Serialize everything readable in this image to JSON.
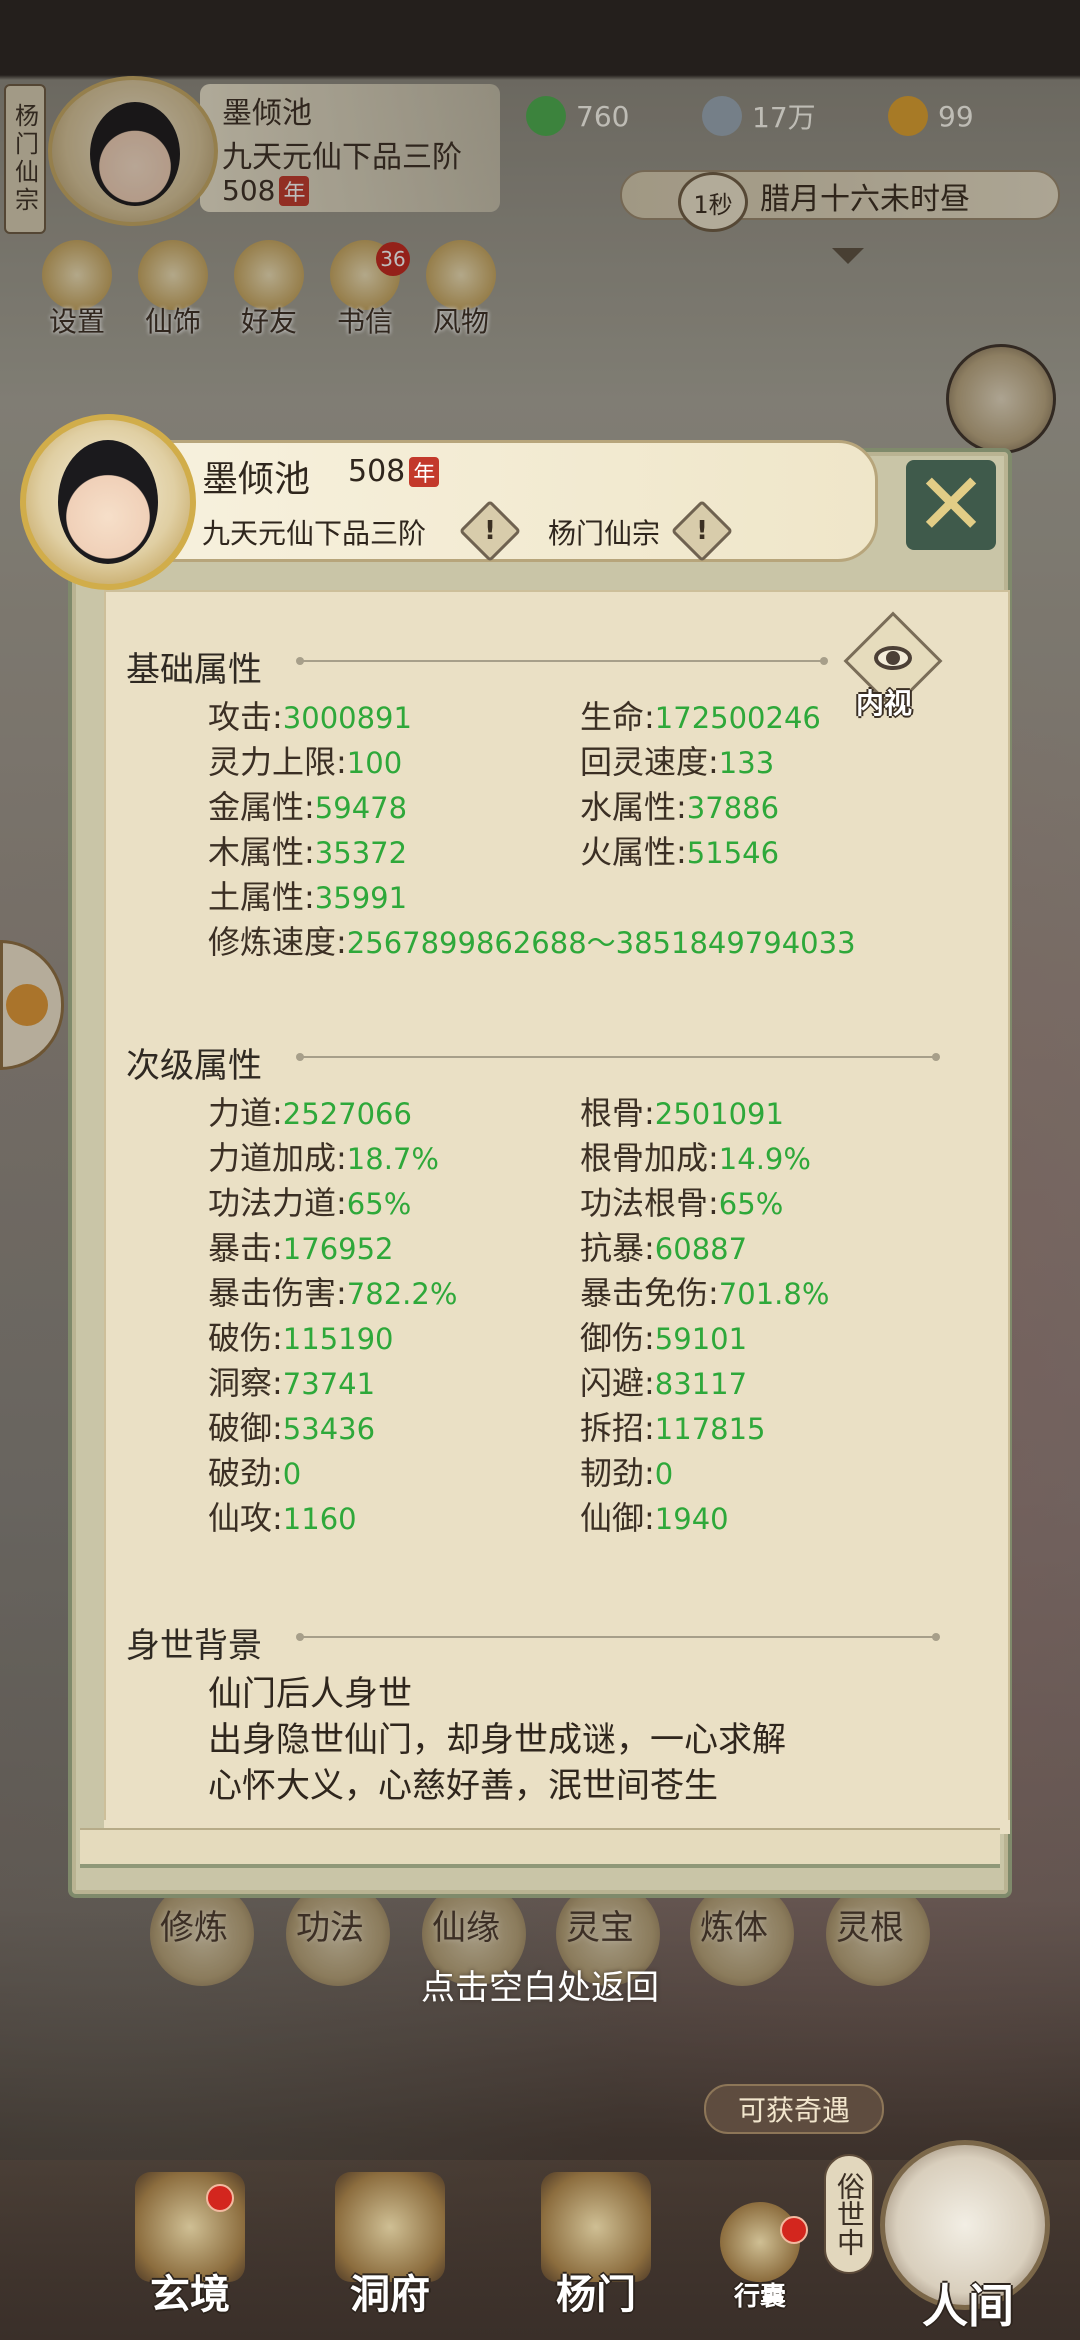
{
  "hud": {
    "sect_tag": "杨门仙宗",
    "name": "墨倾池",
    "rank": "九天元仙下品三阶",
    "age": "508",
    "age_unit": "年",
    "resources": [
      {
        "icon": "jade-leaf-icon",
        "value": "760",
        "color": "#4caf50"
      },
      {
        "icon": "coin-icon",
        "value": "17万",
        "color": "#9aa9b8"
      },
      {
        "icon": "gold-ingot-icon",
        "value": "99",
        "color": "#e0a330"
      }
    ],
    "time_speed": "1秒",
    "game_time": "腊月十六未时昼",
    "buttons": [
      {
        "label": "设置",
        "icon": "settings-icon"
      },
      {
        "label": "仙饰",
        "icon": "costume-icon"
      },
      {
        "label": "好友",
        "icon": "friends-icon"
      },
      {
        "label": "书信",
        "icon": "letter-icon"
      },
      {
        "label": "风物",
        "icon": "scenery-icon"
      }
    ],
    "mail_count": "36"
  },
  "modal": {
    "name": "墨倾池",
    "age": "508",
    "age_unit": "年",
    "rank": "九天元仙下品三阶",
    "sect": "杨门仙宗",
    "close_icon": "close-x-icon",
    "inner_view_label": "内视",
    "basic": {
      "title": "基础属性",
      "items": [
        {
          "label": "攻击",
          "value": "3000891"
        },
        {
          "label": "生命",
          "value": "172500246"
        },
        {
          "label": "灵力上限",
          "value": "100"
        },
        {
          "label": "回灵速度",
          "value": "133"
        },
        {
          "label": "金属性",
          "value": "59478"
        },
        {
          "label": "水属性",
          "value": "37886"
        },
        {
          "label": "木属性",
          "value": "35372"
        },
        {
          "label": "火属性",
          "value": "51546"
        },
        {
          "label": "土属性",
          "value": "35991"
        },
        {
          "label": "修炼速度",
          "value": "2567899862688～3851849794033"
        }
      ]
    },
    "secondary": {
      "title": "次级属性",
      "items": [
        {
          "label": "力道",
          "value": "2527066"
        },
        {
          "label": "根骨",
          "value": "2501091"
        },
        {
          "label": "力道加成",
          "value": "18.7%"
        },
        {
          "label": "根骨加成",
          "value": "14.9%"
        },
        {
          "label": "功法力道",
          "value": "65%"
        },
        {
          "label": "功法根骨",
          "value": "65%"
        },
        {
          "label": "暴击",
          "value": "176952"
        },
        {
          "label": "抗暴",
          "value": "60887"
        },
        {
          "label": "暴击伤害",
          "value": "782.2%"
        },
        {
          "label": "暴击免伤",
          "value": "701.8%"
        },
        {
          "label": "破伤",
          "value": "115190"
        },
        {
          "label": "御伤",
          "value": "59101"
        },
        {
          "label": "洞察",
          "value": "73741"
        },
        {
          "label": "闪避",
          "value": "83117"
        },
        {
          "label": "破御",
          "value": "53436"
        },
        {
          "label": "拆招",
          "value": "117815"
        },
        {
          "label": "破劲",
          "value": "0"
        },
        {
          "label": "韧劲",
          "value": "0"
        },
        {
          "label": "仙攻",
          "value": "1160"
        },
        {
          "label": "仙御",
          "value": "1940"
        }
      ]
    },
    "background": {
      "title": "身世背景",
      "lines": [
        "仙门后人身世",
        "出身隐世仙门，却身世成谜，一心求解",
        "心怀大义，心慈好善，泯世间苍生"
      ]
    }
  },
  "under_modal": {
    "functions": [
      "修炼",
      "功法",
      "仙缘",
      "灵宝",
      "炼体",
      "灵根"
    ],
    "return_hint": "点击空白处返回",
    "adventure_label": "可获奇遇"
  },
  "bottom_nav": {
    "items": [
      {
        "label": "玄境",
        "icon": "mystic-realm-icon"
      },
      {
        "label": "洞府",
        "icon": "cave-dwelling-icon"
      },
      {
        "label": "杨门",
        "icon": "sect-gate-icon"
      },
      {
        "label": "行囊",
        "icon": "bag-icon"
      }
    ],
    "worldly": "俗世中",
    "world": "人间"
  }
}
